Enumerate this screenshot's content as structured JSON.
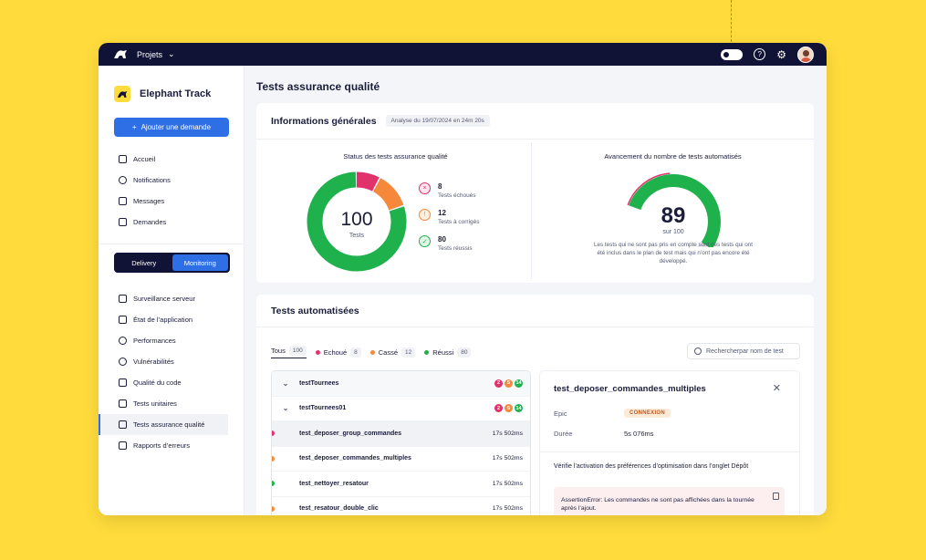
{
  "topbar": {
    "project_label": "Projets"
  },
  "sidebar": {
    "brand": "Elephant Track",
    "add_button": "Ajouter une demande",
    "items": [
      {
        "label": "Accueil"
      },
      {
        "label": "Notifications"
      },
      {
        "label": "Messages"
      },
      {
        "label": "Demandes"
      }
    ],
    "segment": {
      "delivery": "Delivery",
      "monitoring": "Monitoring"
    },
    "items2": [
      {
        "label": "Surveillance serveur"
      },
      {
        "label": "État de l’application"
      },
      {
        "label": "Performances"
      },
      {
        "label": "Vulnérabilités"
      },
      {
        "label": "Qualité du code"
      },
      {
        "label": "Tests unitaires"
      },
      {
        "label": "Tests assurance qualité"
      },
      {
        "label": "Rapports d’erreurs"
      }
    ]
  },
  "main": {
    "title": "Tests assurance qualité",
    "general": {
      "title": "Informations générales",
      "analysis": "Analyse du 19/07/2024 en 24m 20s"
    },
    "status": {
      "title": "Status des tests assurance qualité",
      "total": "100",
      "total_label": "Tests",
      "segments": [
        {
          "label": "Tests échoués",
          "value": 8,
          "color": "#E0326B"
        },
        {
          "label": "Tests à corrigés",
          "value": 12,
          "color": "#F5883A"
        },
        {
          "label": "Tests réussis",
          "value": 80,
          "color": "#1FB24C"
        }
      ],
      "legend": [
        {
          "num": "8",
          "label": "Tests échoués"
        },
        {
          "num": "12",
          "label": "Tests à corrigés"
        },
        {
          "num": "80",
          "label": "Tests réussis"
        }
      ]
    },
    "progress": {
      "title": "Avancement du nombre de tests automatisés",
      "value": "89",
      "sub": "sur 100",
      "fraction": 0.89,
      "note": "Les tests qui ne sont pas pris en compte sont des tests qui ont été inclus dans le plan de test mais qui n’ont pas encore été développé."
    },
    "auto": {
      "title": "Tests automatisées",
      "tabs": [
        {
          "label": "Tous",
          "count": "100"
        },
        {
          "label": "Echoué",
          "count": "8"
        },
        {
          "label": "Cassé",
          "count": "12"
        },
        {
          "label": "Réussi",
          "count": "80"
        }
      ],
      "search_placeholder": "Rechercherpar nom de test",
      "tree": [
        {
          "name": "testTournees",
          "badges": [
            "2",
            "5",
            "14"
          ]
        },
        {
          "name": "testTournees01",
          "badges": [
            "2",
            "5",
            "14"
          ]
        },
        {
          "name": "test_deposer_group_commandes",
          "time": "17s 502ms"
        },
        {
          "name": "test_deposer_commandes_multiples",
          "time": "17s 502ms"
        },
        {
          "name": "test_nettoyer_resatour",
          "time": "17s 502ms"
        },
        {
          "name": "test_resatour_double_clic",
          "time": "17s 502ms"
        }
      ],
      "detail": {
        "title": "test_deposer_commandes_multiples",
        "epic_label": "Epic",
        "epic_value": "CONNEXION",
        "duration_label": "Durée",
        "duration_value": "5s 076ms",
        "description": "Vérifie l’activation des préférences d’optimisation dans l’onglet Dépôt",
        "error": "AssertionError: Les commandes ne sont pas affichées dans la tournée après l’ajout."
      }
    }
  }
}
